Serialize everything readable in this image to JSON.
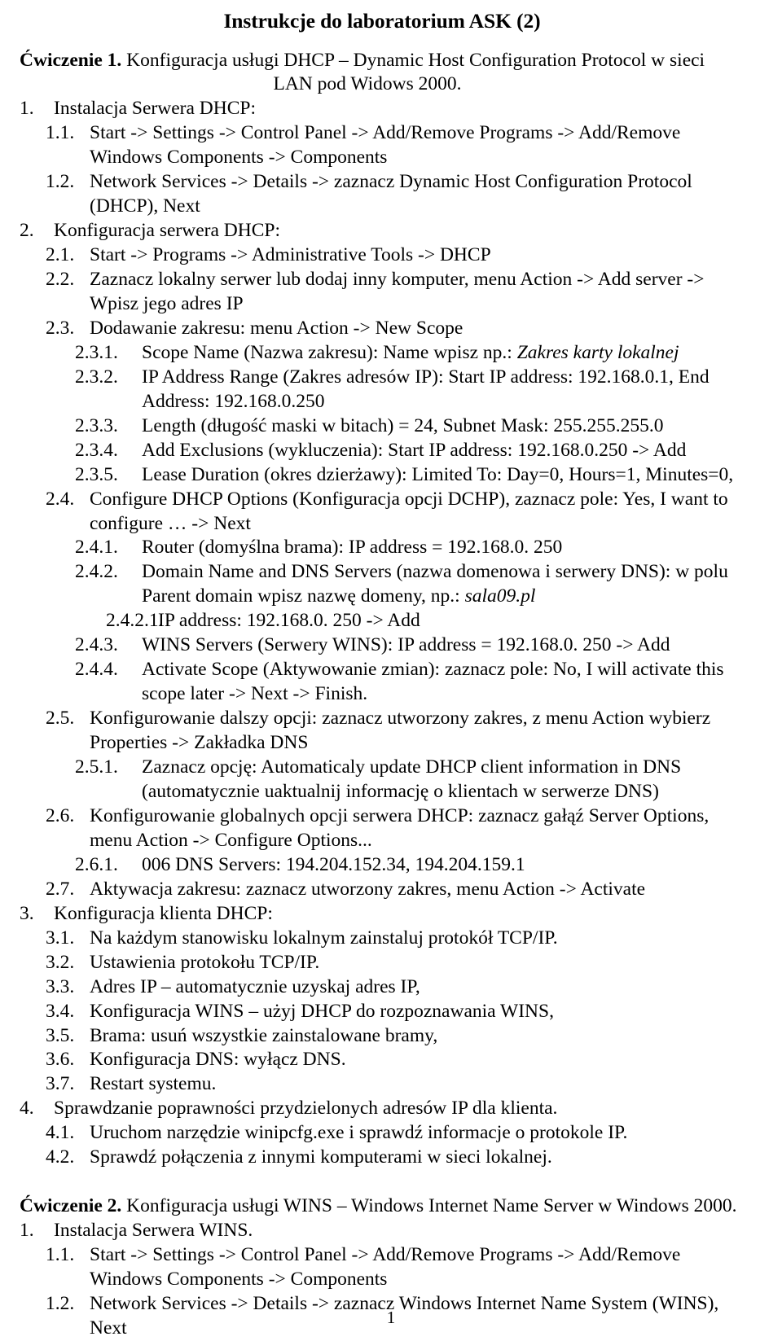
{
  "document": {
    "title": "Instrukcje do laboratorium ASK (2)",
    "page_number": "1"
  },
  "exercise1": {
    "lead": "Ćwiczenie 1.",
    "line1": "Konfiguracja usługi DHCP – Dynamic Host Configuration Protocol w sieci",
    "line2": "LAN pod Widows 2000."
  },
  "exercise2": {
    "lead": "Ćwiczenie 2.",
    "line1": "Konfiguracja usługi WINS – Windows Internet Name Server w Windows 2000."
  },
  "items": {
    "s1": {
      "num": "1.",
      "text": "Instalacja Serwera DHCP:"
    },
    "s1_1": {
      "num": "1.1.",
      "text": "Start -> Settings -> Control Panel -> Add/Remove Programs -> Add/Remove Windows Components -> Components"
    },
    "s1_2": {
      "num": "1.2.",
      "text": "Network Services -> Details -> zaznacz Dynamic Host Configuration Protocol (DHCP), Next"
    },
    "s2": {
      "num": "2.",
      "text": "Konfiguracja serwera DHCP:"
    },
    "s2_1": {
      "num": "2.1.",
      "text": "Start -> Programs -> Administrative Tools -> DHCP"
    },
    "s2_2": {
      "num": "2.2.",
      "text": "Zaznacz lokalny serwer lub dodaj inny komputer, menu Action -> Add server -> Wpisz jego adres IP"
    },
    "s2_3": {
      "num": "2.3.",
      "text": "Dodawanie zakresu: menu Action -> New Scope"
    },
    "s2_3_1": {
      "num": "2.3.1.",
      "text_plain": "Scope Name (Nazwa zakresu): Name wpisz np.: ",
      "text_italic": "Zakres karty lokalnej"
    },
    "s2_3_2": {
      "num": "2.3.2.",
      "text": "IP Address Range (Zakres adresów IP): Start IP address: 192.168.0.1, End Address: 192.168.0.250"
    },
    "s2_3_3": {
      "num": "2.3.3.",
      "text": "Length (długość maski w bitach) = 24, Subnet Mask: 255.255.255.0"
    },
    "s2_3_4": {
      "num": "2.3.4.",
      "text": "Add Exclusions (wykluczenia): Start IP address: 192.168.0.250 -> Add"
    },
    "s2_3_5": {
      "num": "2.3.5.",
      "text": "Lease Duration (okres dzierżawy): Limited To: Day=0, Hours=1, Minutes=0,"
    },
    "s2_4": {
      "num": "2.4.",
      "text": "Configure DHCP Options (Konfiguracja opcji DCHP), zaznacz pole: Yes, I want to configure … -> Next"
    },
    "s2_4_1": {
      "num": "2.4.1.",
      "text": "Router (domyślna brama): IP address = 192.168.0. 250"
    },
    "s2_4_2": {
      "num": "2.4.2.",
      "text_plain": "Domain Name and DNS Servers (nazwa domenowa i serwery DNS): w polu Parent domain wpisz nazwę domeny, np.: ",
      "text_italic": "sala09.pl"
    },
    "s2_4_2_1": {
      "num": "2.4.2.1.",
      "text": "IP address: 192.168.0. 250 -> Add"
    },
    "s2_4_3": {
      "num": "2.4.3.",
      "text": "WINS Servers (Serwery WINS): IP address = 192.168.0. 250 -> Add"
    },
    "s2_4_4": {
      "num": "2.4.4.",
      "text": "Activate Scope (Aktywowanie zmian): zaznacz pole: No, I will activate this scope later -> Next -> Finish."
    },
    "s2_5": {
      "num": "2.5.",
      "text": "Konfigurowanie dalszy opcji: zaznacz utworzony zakres, z menu Action wybierz Properties -> Zakładka DNS"
    },
    "s2_5_1": {
      "num": "2.5.1.",
      "text": "Zaznacz opcję: Automaticaly update DHCP client information in DNS (automatycznie uaktualnij informację o klientach w serwerze DNS)"
    },
    "s2_6": {
      "num": "2.6.",
      "text": "Konfigurowanie globalnych opcji serwera DHCP: zaznacz gałąź Server Options, menu Action -> Configure Options..."
    },
    "s2_6_1": {
      "num": "2.6.1.",
      "text": "006 DNS Servers: 194.204.152.34, 194.204.159.1"
    },
    "s2_7": {
      "num": "2.7.",
      "text": "Aktywacja zakresu: zaznacz utworzony zakres, menu Action -> Activate"
    },
    "s3": {
      "num": "3.",
      "text": "Konfiguracja klienta DHCP:"
    },
    "s3_1": {
      "num": "3.1.",
      "text": "Na każdym stanowisku lokalnym zainstaluj protokół TCP/IP."
    },
    "s3_2": {
      "num": "3.2.",
      "text": "Ustawienia protokołu TCP/IP."
    },
    "s3_3": {
      "num": "3.3.",
      "text": "Adres IP – automatycznie uzyskaj adres IP,"
    },
    "s3_4": {
      "num": "3.4.",
      "text": "Konfiguracja WINS – użyj DHCP do rozpoznawania WINS,"
    },
    "s3_5": {
      "num": "3.5.",
      "text": "Brama: usuń wszystkie zainstalowane bramy,"
    },
    "s3_6": {
      "num": "3.6.",
      "text": "Konfiguracja DNS: wyłącz DNS."
    },
    "s3_7": {
      "num": "3.7.",
      "text": "Restart systemu."
    },
    "s4": {
      "num": "4.",
      "text": "Sprawdzanie poprawności przydzielonych adresów IP dla klienta."
    },
    "s4_1": {
      "num": "4.1.",
      "text": "Uruchom narzędzie winipcfg.exe i sprawdź informacje o protokole IP."
    },
    "s4_2": {
      "num": "4.2.",
      "text": "Sprawdź połączenia z innymi komputerami w sieci lokalnej."
    },
    "w1": {
      "num": "1.",
      "text": "Instalacja Serwera WINS."
    },
    "w1_1": {
      "num": "1.1.",
      "text": "Start -> Settings -> Control Panel -> Add/Remove Programs -> Add/Remove Windows Components -> Components"
    },
    "w1_2": {
      "num": "1.2.",
      "text": "Network Services -> Details -> zaznacz Windows Internet Name System (WINS), Next"
    }
  }
}
